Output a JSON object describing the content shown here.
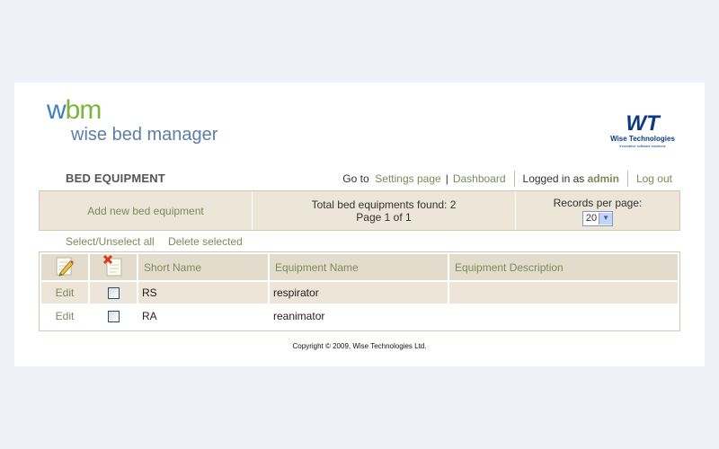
{
  "logo": {
    "mark_w": "w",
    "mark_bm": "bm",
    "name": "wise bed manager"
  },
  "vendor": {
    "mark": "WT",
    "name": "Wise Technologies",
    "tagline": "Innovative software solutions"
  },
  "page_title": "BED EQUIPMENT",
  "topnav": {
    "goto_label": "Go to",
    "settings_link": "Settings page",
    "separator": "|",
    "dashboard_link": "Dashboard",
    "logged_in_label": "Logged in as",
    "user": "admin",
    "logout_link": "Log out"
  },
  "info": {
    "add_link": "Add new bed equipment",
    "total_text": "Total bed equipments found: 2",
    "page_text": "Page 1 of 1",
    "records_label": "Records per page:",
    "records_value": "20"
  },
  "actions": {
    "select_all": "Select/Unselect all",
    "delete_selected": "Delete selected"
  },
  "table": {
    "columns": [
      "Short Name",
      "Equipment Name",
      "Equipment Description"
    ],
    "rows": [
      {
        "edit": "Edit",
        "short": "RS",
        "name": "respirator",
        "description": ""
      },
      {
        "edit": "Edit",
        "short": "RA",
        "name": "reanimator",
        "description": ""
      }
    ]
  },
  "icons": {
    "edit_column": "pencil-note-icon",
    "delete_column": "delete-note-icon"
  },
  "colors": {
    "link": "#7d8a5a",
    "panel": "#ece5d8",
    "header": "#e3dccd",
    "brand_blue": "#3f7ebf",
    "brand_green": "#7fb43a"
  },
  "copyright": "Copyright © 2009, Wise Technologies Ltd."
}
